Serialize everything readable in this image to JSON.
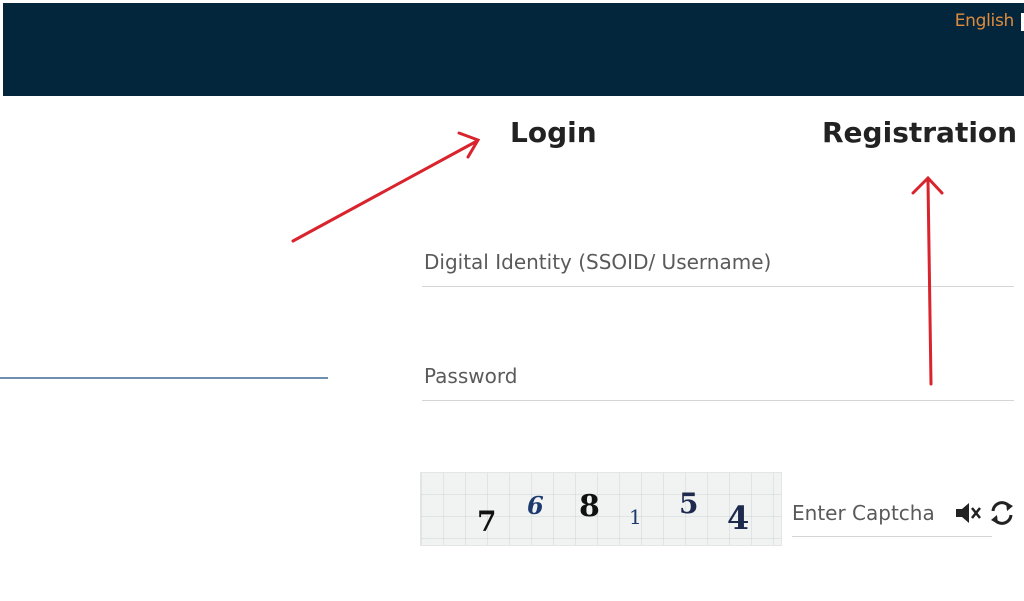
{
  "header": {
    "language_label": "English",
    "background_color": "#04263d",
    "language_color": "#e08a3a"
  },
  "tabs": {
    "login_label": "Login",
    "registration_label": "Registration"
  },
  "form": {
    "username_placeholder": "Digital Identity (SSOID/ Username)",
    "password_placeholder": "Password",
    "captcha_placeholder": "Enter Captcha"
  },
  "captcha": {
    "digits": [
      "7",
      "6",
      "8",
      "1",
      "5",
      "4"
    ]
  },
  "icons": {
    "audio": "speaker-icon",
    "refresh": "refresh-icon"
  },
  "annotation_color": "#d9232d"
}
